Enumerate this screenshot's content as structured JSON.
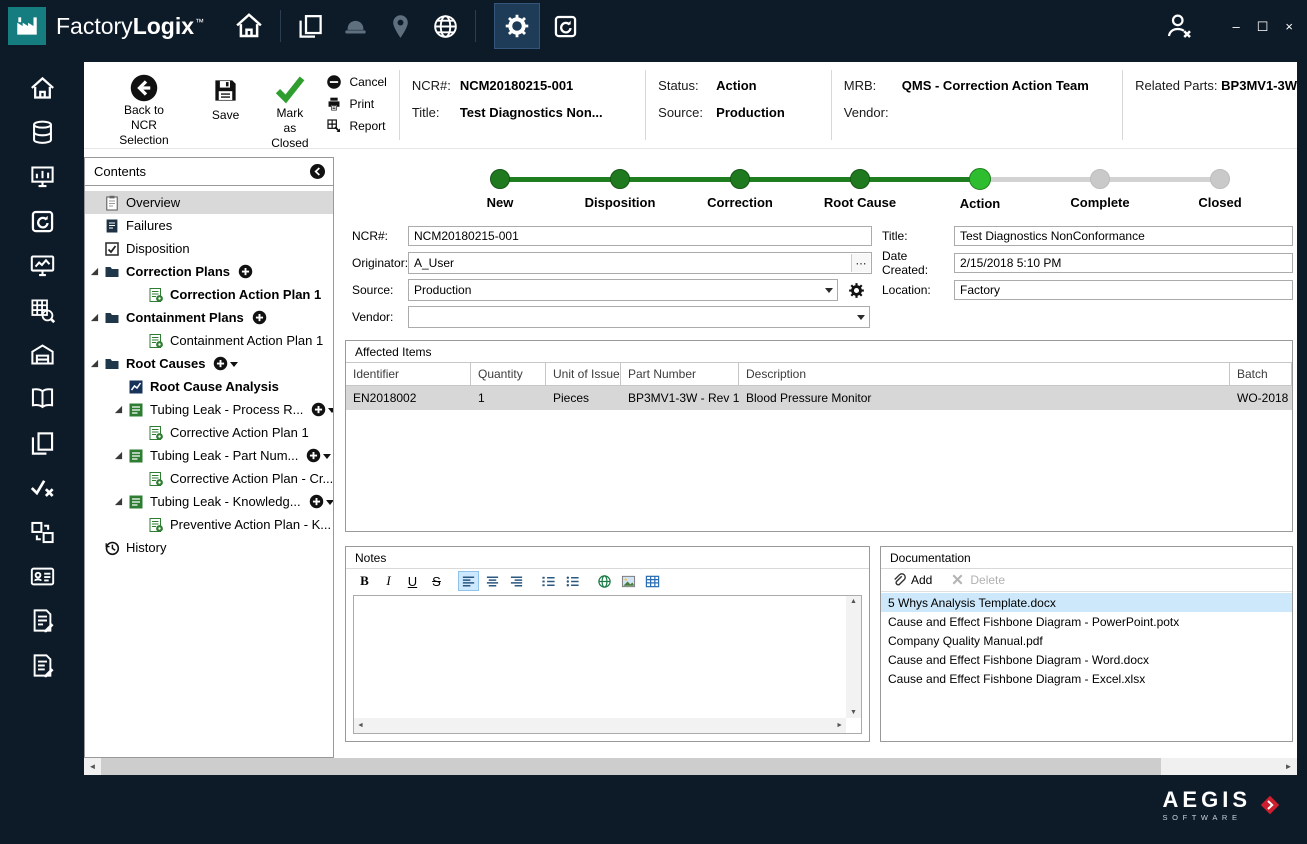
{
  "topbar": {
    "brand_part1": "Factory",
    "brand_part2": "Logix",
    "brand_tm": "™"
  },
  "window": {
    "minimize": "–",
    "maximize": "☐",
    "close": "×"
  },
  "colors": {
    "navy": "#0d1b29",
    "teal": "#157c80",
    "green_done": "#1f7a1f",
    "green_active": "#2ebd2e",
    "selection_gray": "#d9d9d9",
    "selection_blue": "#cde8fa"
  },
  "sidebar": {
    "items": [
      {
        "name": "nav-home-icon",
        "icon": "home"
      },
      {
        "name": "nav-materials-icon",
        "icon": "db"
      },
      {
        "name": "nav-planning-icon",
        "icon": "board"
      },
      {
        "name": "nav-nc-sync-icon",
        "icon": "syncbox"
      },
      {
        "name": "nav-production-icon",
        "icon": "monitor"
      },
      {
        "name": "nav-analytics-icon",
        "icon": "gridsearch"
      },
      {
        "name": "nav-warehouse-icon",
        "icon": "warehouse"
      },
      {
        "name": "nav-documentation-icon",
        "icon": "book"
      },
      {
        "name": "nav-copy-icon",
        "icon": "copy"
      },
      {
        "name": "nav-quality-icon",
        "icon": "checkx"
      },
      {
        "name": "nav-transfer-icon",
        "icon": "transfer"
      },
      {
        "name": "nav-badge-icon",
        "icon": "card"
      },
      {
        "name": "nav-report-icon",
        "icon": "docedit"
      },
      {
        "name": "nav-report2-icon",
        "icon": "docedit2"
      }
    ]
  },
  "toolbar": {
    "back_line1": "Back to",
    "back_line2": "NCR Selection",
    "save": "Save",
    "mark_line1": "Mark as",
    "mark_line2": "Closed",
    "cancel": "Cancel",
    "print": "Print",
    "report": "Report",
    "info": {
      "ncr_label": "NCR#:",
      "ncr_value": "NCM20180215-001",
      "title_label": "Title:",
      "title_value": "Test Diagnostics Non...",
      "status_label": "Status:",
      "status_value": "Action",
      "source_label": "Source:",
      "source_value": "Production",
      "mrb_label": "MRB:",
      "mrb_value": "QMS - Correction Action Team",
      "vendor_label": "Vendor:",
      "vendor_value": "",
      "related_label": "Related Parts:",
      "related_value": "BP3MV1-3W"
    }
  },
  "contents": {
    "title": "Contents",
    "tree": [
      {
        "label": "Overview",
        "icon": "clipboard",
        "level": 0,
        "selected": true
      },
      {
        "label": "Failures",
        "icon": "failure",
        "level": 0
      },
      {
        "label": "Disposition",
        "icon": "checkbox",
        "level": 0
      },
      {
        "label": "Correction Plans",
        "icon": "folder",
        "level": 0,
        "bold": true,
        "expanded": true,
        "action": "plus"
      },
      {
        "label": "Correction Action Plan 1",
        "icon": "plan",
        "level": 2,
        "bold": true
      },
      {
        "label": "Containment Plans",
        "icon": "folder",
        "level": 0,
        "bold": true,
        "expanded": true,
        "action": "plus"
      },
      {
        "label": "Containment Action Plan 1",
        "icon": "plan",
        "level": 2
      },
      {
        "label": "Root Causes",
        "icon": "folder",
        "level": 0,
        "bold": true,
        "expanded": true,
        "action": "plus-menu"
      },
      {
        "label": "Root Cause Analysis",
        "icon": "analysis",
        "level": 1,
        "bold": true
      },
      {
        "label": "Tubing Leak - Process R...",
        "icon": "cause",
        "level": 1,
        "expanded": true,
        "action": "plus-menu"
      },
      {
        "label": "Corrective Action Plan 1",
        "icon": "plan",
        "level": 2
      },
      {
        "label": "Tubing Leak - Part Num...",
        "icon": "cause",
        "level": 1,
        "expanded": true,
        "action": "plus-menu"
      },
      {
        "label": "Corrective Action Plan - Cr...",
        "icon": "plan",
        "level": 2
      },
      {
        "label": "Tubing Leak - Knowledg...",
        "icon": "cause",
        "level": 1,
        "expanded": true,
        "action": "plus-menu"
      },
      {
        "label": "Preventive Action Plan - K...",
        "icon": "plan",
        "level": 2
      },
      {
        "label": "History",
        "icon": "history",
        "level": 0
      }
    ]
  },
  "stepper": {
    "steps": [
      {
        "label": "New",
        "state": "complete"
      },
      {
        "label": "Disposition",
        "state": "complete"
      },
      {
        "label": "Correction",
        "state": "complete"
      },
      {
        "label": "Root Cause",
        "state": "complete"
      },
      {
        "label": "Action",
        "state": "active"
      },
      {
        "label": "Complete",
        "state": "pending"
      },
      {
        "label": "Closed",
        "state": "pending"
      }
    ]
  },
  "form": {
    "ncr": {
      "label": "NCR#:",
      "value": "NCM20180215-001"
    },
    "title": {
      "label": "Title:",
      "value": "Test Diagnostics NonConformance"
    },
    "originator": {
      "label": "Originator:",
      "value": "A_User",
      "browse": "⋯"
    },
    "date_created": {
      "label": "Date Created:",
      "value": "2/15/2018 5:10 PM"
    },
    "source": {
      "label": "Source:",
      "value": "Production"
    },
    "location": {
      "label": "Location:",
      "value": "Factory"
    },
    "vendor": {
      "label": "Vendor:",
      "value": ""
    }
  },
  "affected_items": {
    "title": "Affected Items",
    "columns": [
      "Identifier",
      "Quantity",
      "Unit of Issue",
      "Part Number",
      "Description",
      "Batch"
    ],
    "rows": [
      [
        "EN2018002",
        "1",
        "Pieces",
        "BP3MV1-3W  - Rev 1",
        "Blood Pressure Monitor",
        "WO-2018"
      ]
    ],
    "selected_row": 0
  },
  "notes": {
    "title": "Notes",
    "toolbar": [
      "bold",
      "italic",
      "underline",
      "strike",
      "align-left",
      "align-center",
      "align-right",
      "list-number",
      "list-bullet",
      "link",
      "image",
      "table"
    ],
    "active": "align-left",
    "content": ""
  },
  "documentation": {
    "title": "Documentation",
    "add": "Add",
    "delete": "Delete",
    "files": [
      "5 Whys Analysis Template.docx",
      "Cause and Effect Fishbone Diagram - PowerPoint.potx",
      "Company Quality Manual.pdf",
      "Cause and Effect Fishbone Diagram - Word.docx",
      "Cause and Effect Fishbone Diagram - Excel.xlsx"
    ],
    "selected_index": 0
  },
  "scroll": {
    "up": "▲",
    "down": "▼",
    "left": "◄",
    "right": "►"
  },
  "footer": {
    "brand": "AEGIS",
    "subtitle": "SOFTWARE"
  }
}
